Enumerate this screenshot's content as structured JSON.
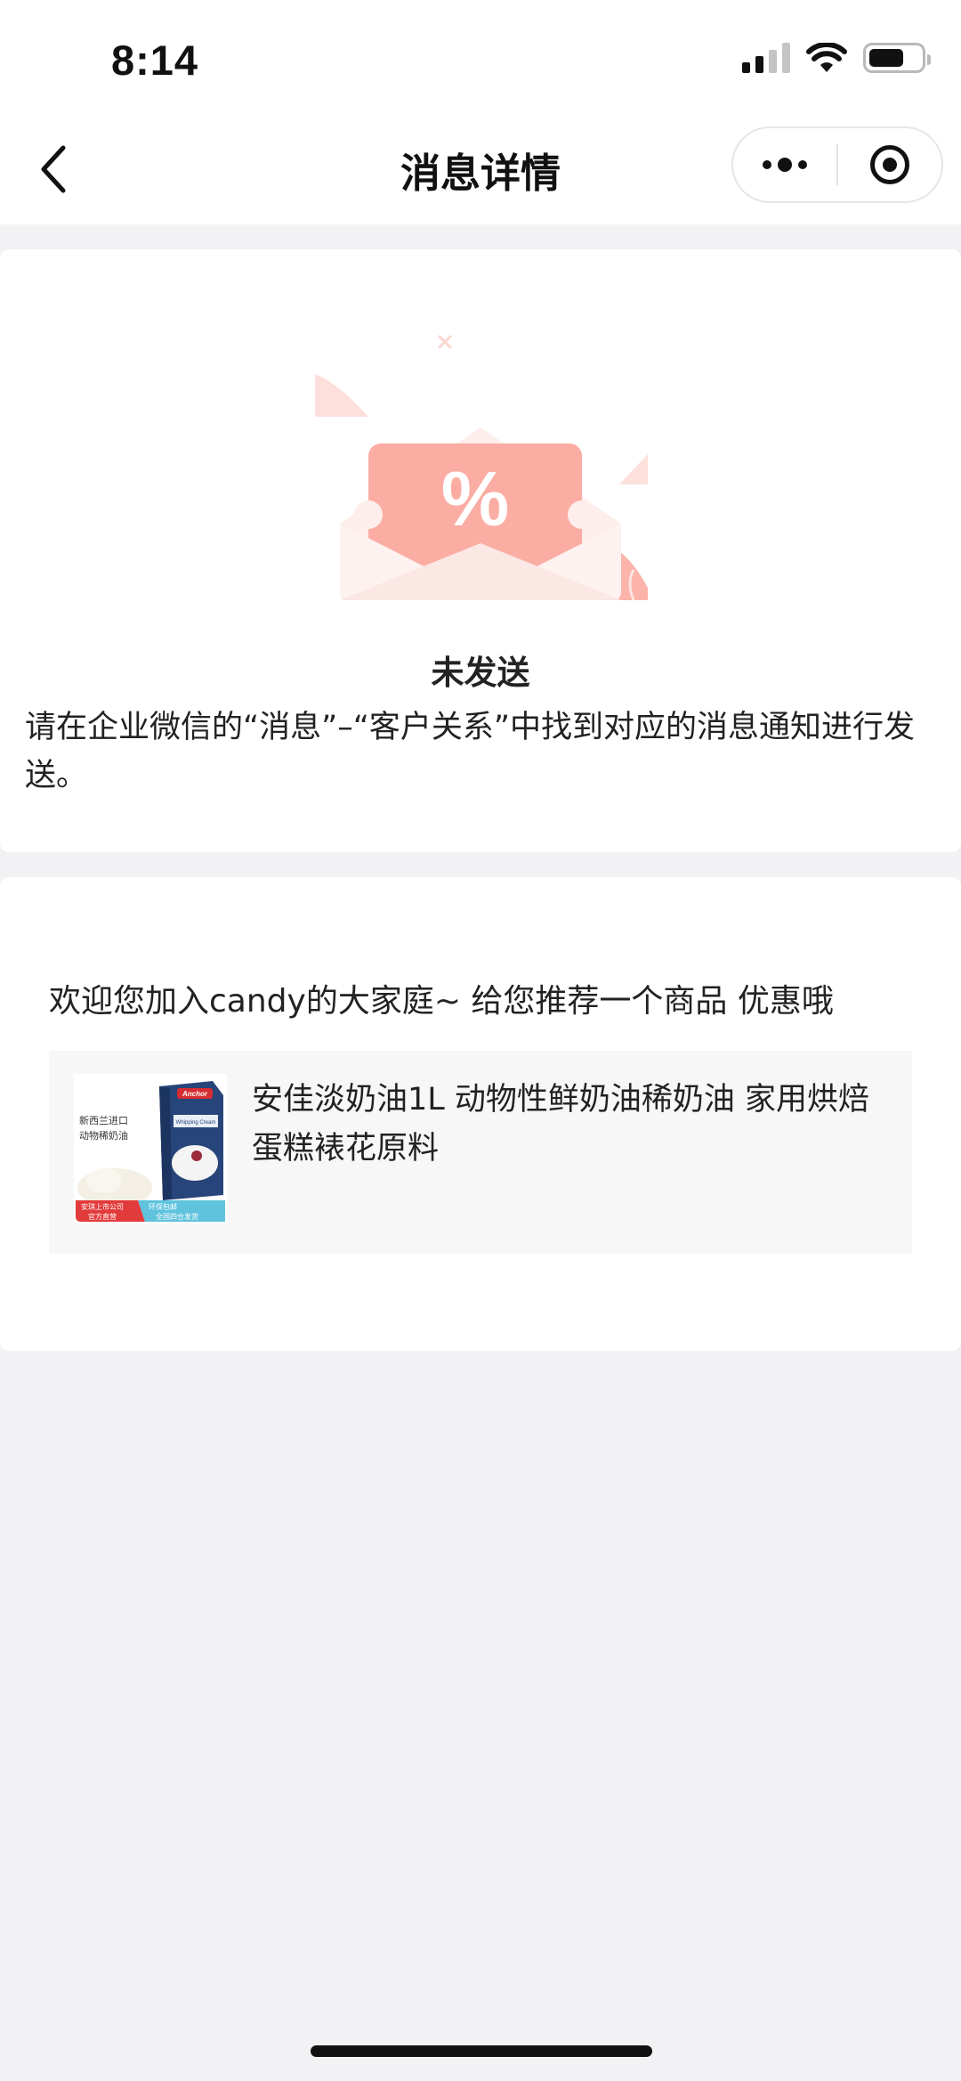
{
  "status_bar": {
    "time": "8:14"
  },
  "nav": {
    "title": "消息详情",
    "more_icon": "ellipsis-icon",
    "miniapp_icon": "target-icon"
  },
  "message": {
    "status_title": "未发送",
    "notice_text": "请在企业微信的“消息”–“客户关系”中找到对应的消息通知进行发送。",
    "illustration_icon": "envelope-percent-icon"
  },
  "content": {
    "welcome_text": "欢迎您加入candy的大家庭~ 给您推荐一个商品 优惠哦",
    "product": {
      "name": "安佳淡奶油1L 动物性鲜奶油稀奶油 家用烘焙蛋糕裱花原料",
      "thumb_tag_origin": "新西兰进口",
      "thumb_tag_type": "动物稀奶油",
      "thumb_badge_left_1": "安琪上市公司",
      "thumb_badge_left_2": "官方直营",
      "thumb_badge_right_1": "环保包邮",
      "thumb_badge_right_2": "全国四仓发货",
      "thumb_brand": "Anchor",
      "thumb_box_label": "Whipping Cream"
    }
  },
  "colors": {
    "accent_pink": "#fbada4",
    "envelope": "#fdebe9",
    "background": "#f2f2f4"
  }
}
